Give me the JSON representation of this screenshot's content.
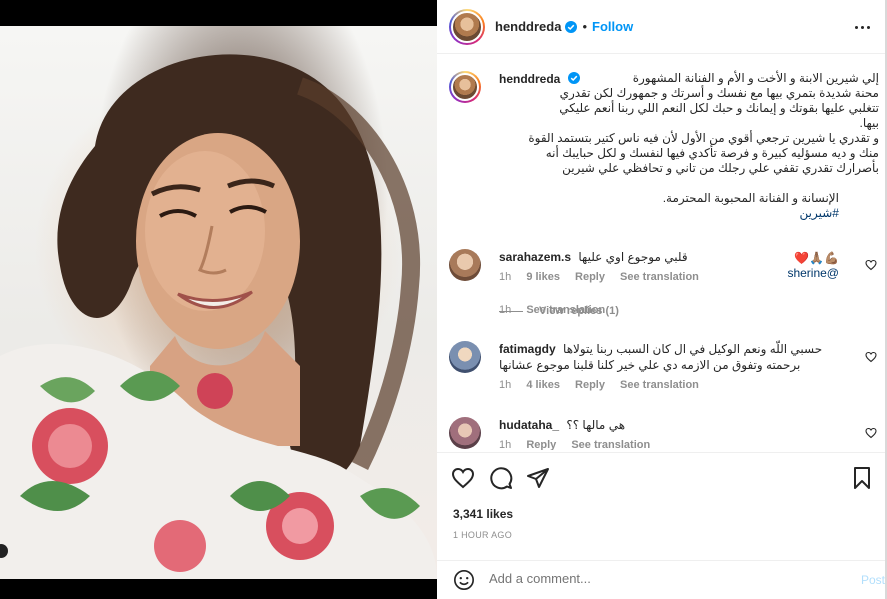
{
  "post_header": {
    "username": "henddreda",
    "follow_label": "Follow",
    "dot": "•"
  },
  "caption": {
    "username": "henddreda",
    "lines": [
      "إلي شيرين الابنة و الأخت و الأم و الفنانة المشهورة",
      "محنة شديدة بتمري بيها مع نفسك و أسرتك و جمهورك لكن تقدري",
      "تتغلبي عليها بقوتك و إيمانك و حبك لكل النعم اللي ربنا أنعم عليكي",
      "بيها.",
      "و تقدري يا شيرين ترجعي أقوي من الأول لأن فيه ناس كتير بتستمد القوة",
      "منك و ديه مسؤليه كبيرة و فرصة تأكدي فيها لنفسك و لكل حبايبك أنه",
      "بأصرارك تقدري تقفي علي رجلك من تاني و تحافظي علي شيرين",
      "الإنسانة و الفنانة المحبوبة المحترمة."
    ],
    "hashtag": "#شيرين",
    "emoji": "💪🏽🙏🏽❤️",
    "mention": "@sherine",
    "time": "1h",
    "see_translation": "See translation"
  },
  "comments": [
    {
      "username": "sarahazem.s",
      "text": "قلبي موجوع اوي عليها",
      "time": "1h",
      "likes": "9 likes",
      "reply": "Reply",
      "see_translation": "See translation",
      "view_replies": "View replies (1)"
    },
    {
      "username": "fatimagdy",
      "text": "حسبي اللّه ونعم الوكيل في ال كان السبب ربنا يتولاها",
      "text2": "برحمته وتفوق من الازمه دي علي خير كلنا قلبنا موجوع عشانها",
      "time": "1h",
      "likes": "4 likes",
      "reply": "Reply",
      "see_translation": "See translation"
    },
    {
      "username": "hudataha_",
      "text": "هي مالها ؟؟",
      "time": "1h",
      "reply": "Reply",
      "see_translation": "See translation"
    }
  ],
  "actions": {
    "likes": "3,341 likes",
    "timestamp": "1 HOUR AGO"
  },
  "add_comment": {
    "placeholder": "Add a comment...",
    "post_label": "Post"
  },
  "icons": {
    "like": "heart-icon",
    "comment": "comment-icon",
    "share": "share-icon",
    "save": "bookmark-icon",
    "more": "more-options-icon",
    "emoji": "emoji-icon",
    "verified": "verified-badge-icon"
  },
  "colors": {
    "accent": "#0095f6",
    "muted": "#8e8e8e",
    "link": "#00376b",
    "post_disabled": "#b2dffc"
  }
}
